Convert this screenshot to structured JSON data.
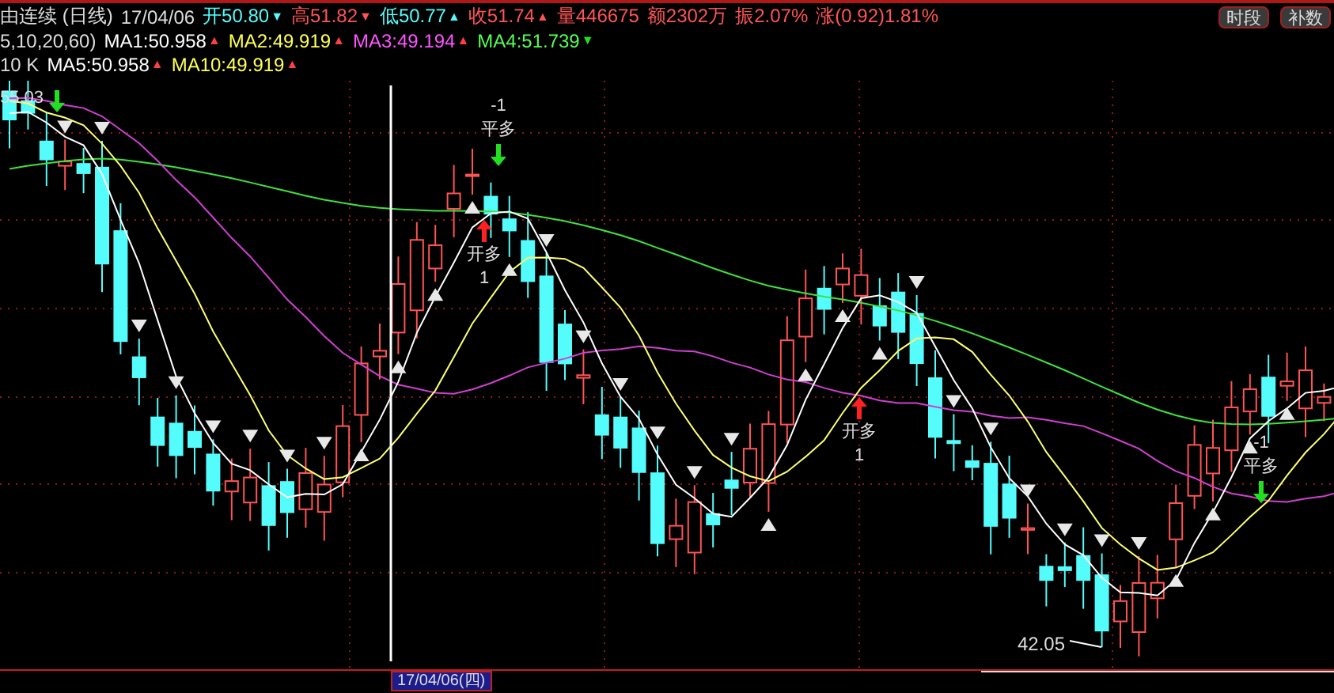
{
  "title": {
    "name": "由连续 (日线)",
    "date": "17/04/06"
  },
  "quote": [
    {
      "label": "开50.80",
      "color": "#54fcfc",
      "arrow": "▼"
    },
    {
      "label": "高51.82",
      "color": "#ff5454",
      "arrow": "▼"
    },
    {
      "label": "低50.77",
      "color": "#54fcfc",
      "arrow": "▲"
    },
    {
      "label": "收51.74",
      "color": "#ff5454",
      "arrow": "▲"
    },
    {
      "label": "量446675",
      "color": "#ff5454"
    },
    {
      "label": "额2302万",
      "color": "#ff5454"
    },
    {
      "label": "振2.07%",
      "color": "#ff5454"
    },
    {
      "label": "涨(0.92)1.81%",
      "color": "#ff5454"
    }
  ],
  "buttons": [
    {
      "label": "时段"
    },
    {
      "label": "补数"
    }
  ],
  "ma_rows": [
    {
      "params": "5,10,20,60)",
      "items": [
        {
          "label": "MA1:50.958",
          "color": "#ffffff",
          "arrow": {
            "glyph": "▲",
            "color": "#ff4040"
          }
        },
        {
          "label": "MA2:49.919",
          "color": "#ffff54",
          "arrow": {
            "glyph": "▲",
            "color": "#ff4040"
          }
        },
        {
          "label": "MA3:49.194",
          "color": "#ff54ff",
          "arrow": {
            "glyph": "▲",
            "color": "#ff4040"
          }
        },
        {
          "label": "MA4:51.739",
          "color": "#54ff54",
          "arrow": {
            "glyph": "▼",
            "color": "#20e020"
          }
        }
      ]
    },
    {
      "params": "10 K",
      "items": [
        {
          "label": "MA5:50.958",
          "color": "#ffffff",
          "arrow": {
            "glyph": "▲",
            "color": "#ff4040"
          }
        },
        {
          "label": "MA10:49.919",
          "color": "#ffff54",
          "arrow": {
            "glyph": "▲",
            "color": "#ff4040"
          }
        }
      ]
    }
  ],
  "chart": {
    "high_label": "55.03",
    "low_label": "42.05",
    "signals": [
      {
        "kind": "close",
        "count": "-1",
        "label": "平多"
      },
      {
        "kind": "open",
        "count": "1",
        "label": "开多"
      },
      {
        "kind": "open",
        "count": "1",
        "label": "开多"
      },
      {
        "kind": "close",
        "count": "-1",
        "label": "平多"
      }
    ]
  },
  "axis": {
    "date": "17/04/06(四)"
  }
}
